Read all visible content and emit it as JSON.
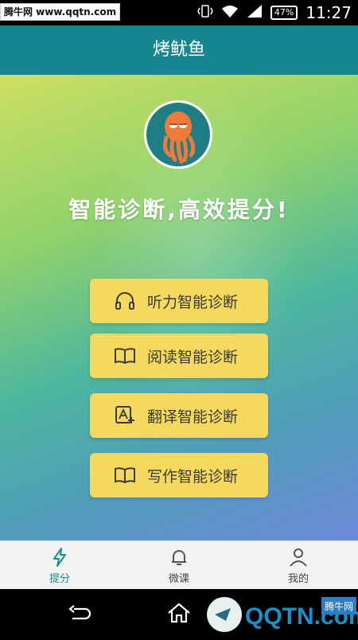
{
  "status_bar": {
    "watermark": "腾牛网 www.qqtn.com",
    "battery": "47%",
    "time": "11:27"
  },
  "header": {
    "title": "烤鱿鱼"
  },
  "hero": {
    "slogan": "智能诊断,高效提分!"
  },
  "buttons": [
    {
      "label": "听力智能诊断",
      "icon": "headphones-icon"
    },
    {
      "label": "阅读智能诊断",
      "icon": "book-icon"
    },
    {
      "label": "翻译智能诊断",
      "icon": "translate-icon"
    },
    {
      "label": "写作智能诊断",
      "icon": "book-icon"
    }
  ],
  "tabs": [
    {
      "label": "提分",
      "icon": "lightning-icon",
      "active": true
    },
    {
      "label": "微课",
      "icon": "bell-icon",
      "active": false
    },
    {
      "label": "我的",
      "icon": "person-icon",
      "active": false
    }
  ],
  "corner_logo": {
    "text": "QQTN.com",
    "badge": "腾牛网"
  },
  "colors": {
    "header": "#18868f",
    "button": "#f5d85e",
    "active_tab": "#1a8d93"
  }
}
